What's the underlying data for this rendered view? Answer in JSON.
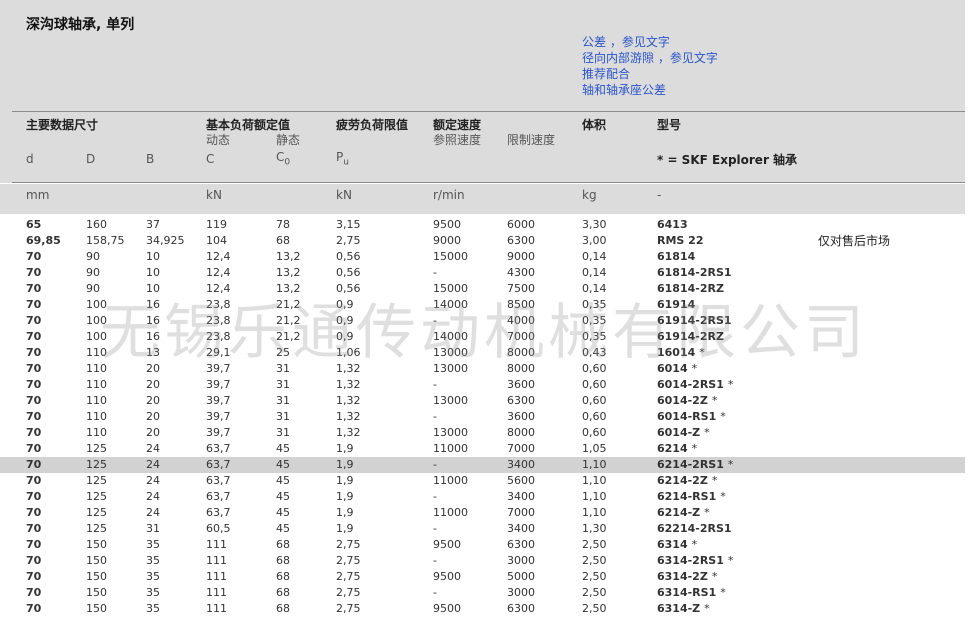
{
  "title": "深沟球轴承, 单列",
  "links": [
    "公差 ，参见文字",
    "径向内部游隙 ，参见文字",
    "推荐配合",
    "轴和轴承座公差"
  ],
  "headers": {
    "dims": "主要数据尺寸",
    "load": "基本负荷额定值",
    "load_dyn": "动态",
    "load_stat": "静态",
    "fatigue": "疲劳负荷限值",
    "speed": "额定速度",
    "speed_ref": "参照速度",
    "speed_lim": "限制速度",
    "mass": "体积",
    "designation": "型号",
    "explorer": "* = SKF Explorer 轴承"
  },
  "symbols": {
    "d": "d",
    "D": "D",
    "B": "B",
    "C": "C",
    "C0_base": "C",
    "C0_sub": "0",
    "Pu_base": "P",
    "Pu_sub": "u"
  },
  "units": {
    "dims": "mm",
    "load": "kN",
    "fatigue": "kN",
    "speed": "r/min",
    "mass": "kg",
    "designation": "-"
  },
  "rows": [
    {
      "d": "65",
      "D": "160",
      "B": "37",
      "C": "119",
      "C0": "78",
      "Pu": "3,15",
      "ref": "9500",
      "lim": "6000",
      "mass": "3,30",
      "des": "6413",
      "star": "",
      "note": ""
    },
    {
      "d": "69,85",
      "D": "158,75",
      "B": "34,925",
      "C": "104",
      "C0": "68",
      "Pu": "2,75",
      "ref": "9000",
      "lim": "6300",
      "mass": "3,00",
      "des": "RMS 22",
      "star": "",
      "note": "仅对售后市场"
    },
    {
      "d": "70",
      "D": "90",
      "B": "10",
      "C": "12,4",
      "C0": "13,2",
      "Pu": "0,56",
      "ref": "15000",
      "lim": "9000",
      "mass": "0,14",
      "des": "61814",
      "star": "",
      "note": ""
    },
    {
      "d": "70",
      "D": "90",
      "B": "10",
      "C": "12,4",
      "C0": "13,2",
      "Pu": "0,56",
      "ref": "-",
      "lim": "4300",
      "mass": "0,14",
      "des": "61814-2RS1",
      "star": "",
      "note": ""
    },
    {
      "d": "70",
      "D": "90",
      "B": "10",
      "C": "12,4",
      "C0": "13,2",
      "Pu": "0,56",
      "ref": "15000",
      "lim": "7500",
      "mass": "0,14",
      "des": "61814-2RZ",
      "star": "",
      "note": ""
    },
    {
      "d": "70",
      "D": "100",
      "B": "16",
      "C": "23,8",
      "C0": "21,2",
      "Pu": "0,9",
      "ref": "14000",
      "lim": "8500",
      "mass": "0,35",
      "des": "61914",
      "star": "",
      "note": ""
    },
    {
      "d": "70",
      "D": "100",
      "B": "16",
      "C": "23,8",
      "C0": "21,2",
      "Pu": "0,9",
      "ref": "-",
      "lim": "4000",
      "mass": "0,35",
      "des": "61914-2RS1",
      "star": "",
      "note": ""
    },
    {
      "d": "70",
      "D": "100",
      "B": "16",
      "C": "23,8",
      "C0": "21,2",
      "Pu": "0,9",
      "ref": "14000",
      "lim": "7000",
      "mass": "0,35",
      "des": "61914-2RZ",
      "star": "",
      "note": ""
    },
    {
      "d": "70",
      "D": "110",
      "B": "13",
      "C": "29,1",
      "C0": "25",
      "Pu": "1,06",
      "ref": "13000",
      "lim": "8000",
      "mass": "0,43",
      "des": "16014",
      "star": "*",
      "note": ""
    },
    {
      "d": "70",
      "D": "110",
      "B": "20",
      "C": "39,7",
      "C0": "31",
      "Pu": "1,32",
      "ref": "13000",
      "lim": "8000",
      "mass": "0,60",
      "des": "6014",
      "star": "*",
      "note": ""
    },
    {
      "d": "70",
      "D": "110",
      "B": "20",
      "C": "39,7",
      "C0": "31",
      "Pu": "1,32",
      "ref": "-",
      "lim": "3600",
      "mass": "0,60",
      "des": "6014-2RS1",
      "star": "*",
      "note": ""
    },
    {
      "d": "70",
      "D": "110",
      "B": "20",
      "C": "39,7",
      "C0": "31",
      "Pu": "1,32",
      "ref": "13000",
      "lim": "6300",
      "mass": "0,60",
      "des": "6014-2Z",
      "star": "*",
      "note": ""
    },
    {
      "d": "70",
      "D": "110",
      "B": "20",
      "C": "39,7",
      "C0": "31",
      "Pu": "1,32",
      "ref": "-",
      "lim": "3600",
      "mass": "0,60",
      "des": "6014-RS1",
      "star": "*",
      "note": ""
    },
    {
      "d": "70",
      "D": "110",
      "B": "20",
      "C": "39,7",
      "C0": "31",
      "Pu": "1,32",
      "ref": "13000",
      "lim": "8000",
      "mass": "0,60",
      "des": "6014-Z",
      "star": "*",
      "note": ""
    },
    {
      "d": "70",
      "D": "125",
      "B": "24",
      "C": "63,7",
      "C0": "45",
      "Pu": "1,9",
      "ref": "11000",
      "lim": "7000",
      "mass": "1,05",
      "des": "6214",
      "star": "*",
      "note": ""
    },
    {
      "d": "70",
      "D": "125",
      "B": "24",
      "C": "63,7",
      "C0": "45",
      "Pu": "1,9",
      "ref": "-",
      "lim": "3400",
      "mass": "1,10",
      "des": "6214-2RS1",
      "star": "*",
      "note": ""
    },
    {
      "d": "70",
      "D": "125",
      "B": "24",
      "C": "63,7",
      "C0": "45",
      "Pu": "1,9",
      "ref": "11000",
      "lim": "5600",
      "mass": "1,10",
      "des": "6214-2Z",
      "star": "*",
      "note": ""
    },
    {
      "d": "70",
      "D": "125",
      "B": "24",
      "C": "63,7",
      "C0": "45",
      "Pu": "1,9",
      "ref": "-",
      "lim": "3400",
      "mass": "1,10",
      "des": "6214-RS1",
      "star": "*",
      "note": ""
    },
    {
      "d": "70",
      "D": "125",
      "B": "24",
      "C": "63,7",
      "C0": "45",
      "Pu": "1,9",
      "ref": "11000",
      "lim": "7000",
      "mass": "1,10",
      "des": "6214-Z",
      "star": "*",
      "note": ""
    },
    {
      "d": "70",
      "D": "125",
      "B": "31",
      "C": "60,5",
      "C0": "45",
      "Pu": "1,9",
      "ref": "-",
      "lim": "3400",
      "mass": "1,30",
      "des": "62214-2RS1",
      "star": "",
      "note": ""
    },
    {
      "d": "70",
      "D": "150",
      "B": "35",
      "C": "111",
      "C0": "68",
      "Pu": "2,75",
      "ref": "9500",
      "lim": "6300",
      "mass": "2,50",
      "des": "6314",
      "star": "*",
      "note": ""
    },
    {
      "d": "70",
      "D": "150",
      "B": "35",
      "C": "111",
      "C0": "68",
      "Pu": "2,75",
      "ref": "-",
      "lim": "3000",
      "mass": "2,50",
      "des": "6314-2RS1",
      "star": "*",
      "note": ""
    },
    {
      "d": "70",
      "D": "150",
      "B": "35",
      "C": "111",
      "C0": "68",
      "Pu": "2,75",
      "ref": "9500",
      "lim": "5000",
      "mass": "2,50",
      "des": "6314-2Z",
      "star": "*",
      "note": ""
    },
    {
      "d": "70",
      "D": "150",
      "B": "35",
      "C": "111",
      "C0": "68",
      "Pu": "2,75",
      "ref": "-",
      "lim": "3000",
      "mass": "2,50",
      "des": "6314-RS1",
      "star": "*",
      "note": ""
    },
    {
      "d": "70",
      "D": "150",
      "B": "35",
      "C": "111",
      "C0": "68",
      "Pu": "2,75",
      "ref": "9500",
      "lim": "6300",
      "mass": "2,50",
      "des": "6314-Z",
      "star": "*",
      "note": ""
    }
  ],
  "highlight_row": 15,
  "watermark": "无锡乐通传动机械有限公司"
}
